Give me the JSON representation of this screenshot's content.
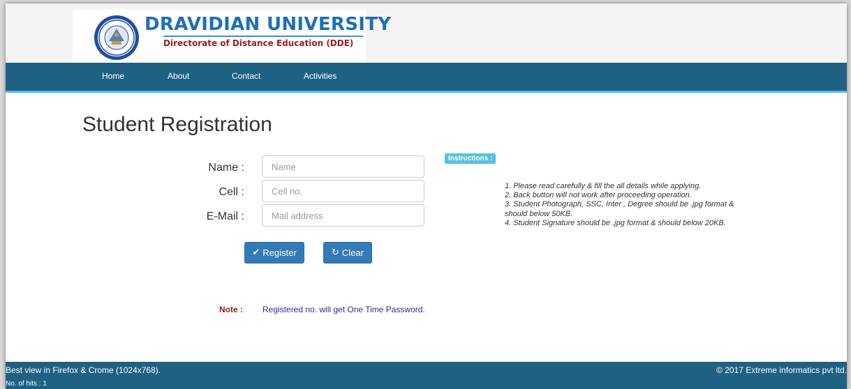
{
  "header": {
    "university_name": "DRAVIDIAN UNIVERSITY",
    "subtitle": "Directorate of Distance Education (DDE)",
    "seal_colors": {
      "ring": "#1f4fa0",
      "inner": "#ffffff",
      "accent": "#c8a030"
    }
  },
  "nav": {
    "items": [
      {
        "label": "Home"
      },
      {
        "label": "About"
      },
      {
        "label": "Contact"
      },
      {
        "label": "Activities"
      }
    ]
  },
  "main": {
    "title": "Student Registration",
    "form": {
      "name_label": "Name :",
      "name_placeholder": "Name",
      "name_value": "",
      "cell_label": "Cell :",
      "cell_placeholder": "Cell no.",
      "cell_value": "",
      "email_label": "E-Mail :",
      "email_placeholder": "Mail address",
      "email_value": "",
      "register_label": "Register",
      "register_icon": "checkmark-icon",
      "clear_label": "Clear",
      "clear_icon": "refresh-icon"
    },
    "instructions": {
      "badge": "Instructions :",
      "lines": [
        "1. Please read carefully & fill the all details while applying.",
        "2. Back button will not work after proceeding operation.",
        "3. Student Photograph, SSC, Inter , Degree should be .jpg format &",
        "should below 50KB.",
        "4. Student Signature should be .jpg format & should below 20KB."
      ]
    },
    "note": {
      "label": "Note :",
      "text": "Registered no. will get One Time Password."
    }
  },
  "footer": {
    "left_text": "Best view in Firefox & Crome (1024x768).",
    "right_text": "© 2017 Extreme informatics pvt ltd.",
    "hits_text": "No. of hits : 1"
  },
  "colors": {
    "navbar": "#1f6183",
    "nav_accent": "#55b4e6",
    "button": "#337ab7",
    "badge": "#5bc0de",
    "note_label": "#8b1a1a",
    "note_text": "#2a2a9a",
    "uni_name": "#1f6fb5",
    "uni_sub": "#9a1e1e"
  }
}
